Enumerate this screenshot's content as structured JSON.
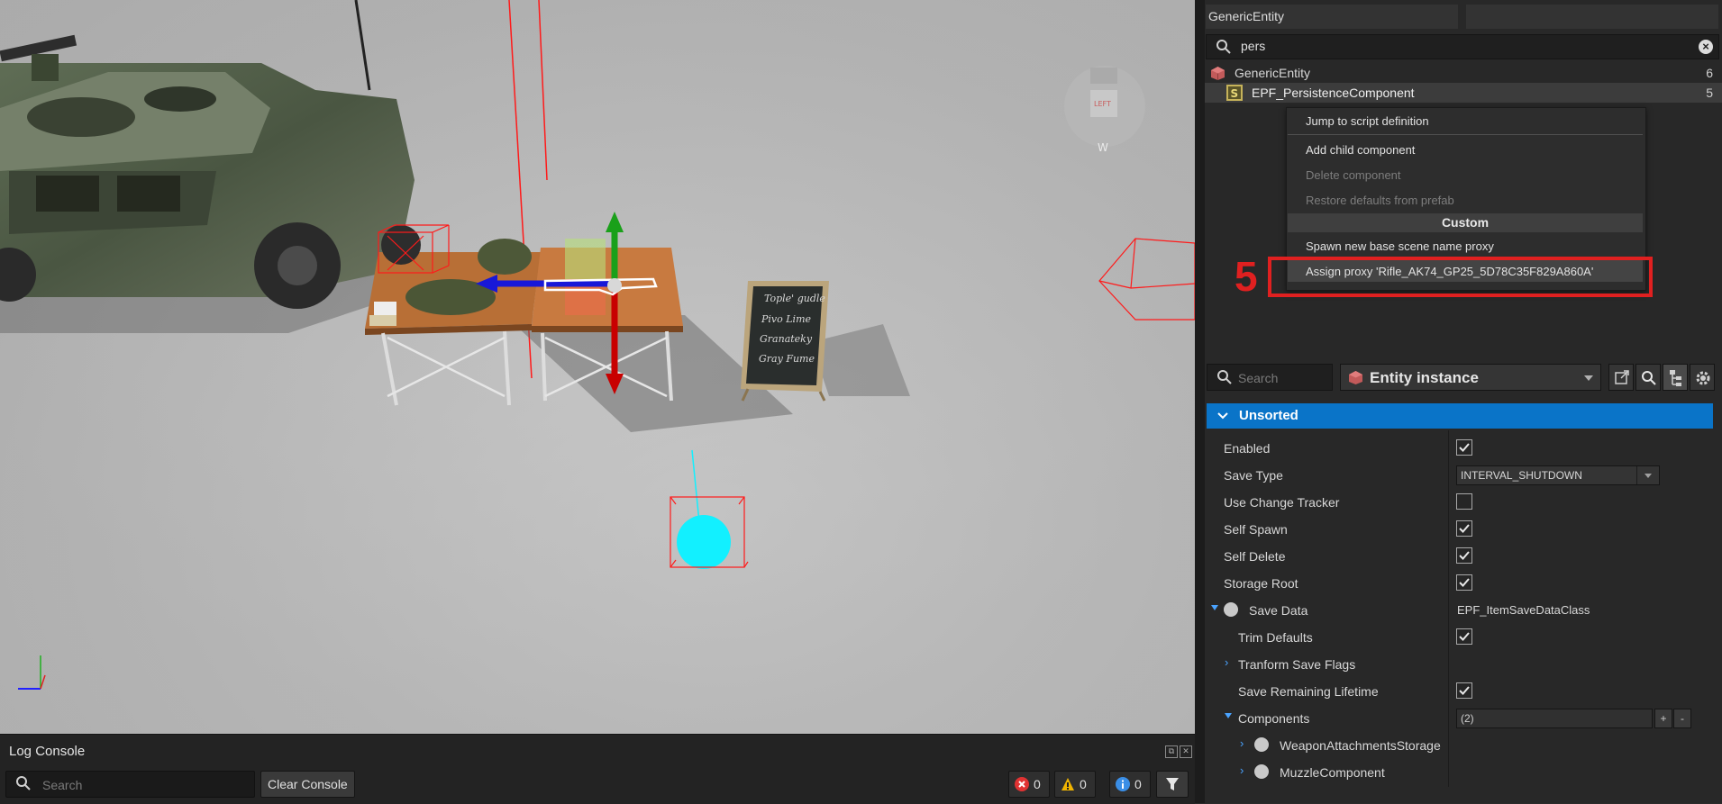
{
  "hierarchy": {
    "entity_field": "GenericEntity",
    "search_value": "pers",
    "rows": [
      {
        "label": "GenericEntity",
        "count": "6"
      },
      {
        "label": "EPF_PersistenceComponent",
        "count": "5"
      }
    ]
  },
  "context_menu": {
    "items": {
      "jump": "Jump to script definition",
      "add_child": "Add child component",
      "delete": "Delete component",
      "restore": "Restore defaults from prefab",
      "custom_header": "Custom",
      "spawn_proxy": "Spawn new base scene name proxy",
      "assign_proxy": "Assign proxy 'Rifle_AK74_GP25_5D78C35F829A860A'"
    }
  },
  "annotation": {
    "step": "5",
    "color": "#e02020"
  },
  "properties": {
    "search_placeholder": "Search",
    "type_label": "Entity instance",
    "section": "Unsorted",
    "rows": {
      "enabled": {
        "label": "Enabled",
        "checked": true
      },
      "save_type": {
        "label": "Save Type",
        "value": "INTERVAL_SHUTDOWN"
      },
      "use_change_tracker": {
        "label": "Use Change Tracker",
        "checked": false
      },
      "self_spawn": {
        "label": "Self Spawn",
        "checked": true
      },
      "self_delete": {
        "label": "Self Delete",
        "checked": true
      },
      "storage_root": {
        "label": "Storage Root",
        "checked": true
      },
      "save_data": {
        "label": "Save Data",
        "value": "EPF_ItemSaveDataClass"
      },
      "trim_defaults": {
        "label": "Trim Defaults",
        "checked": true
      },
      "transform_flags": {
        "label": "Tranform Save Flags"
      },
      "save_remaining_lifetime": {
        "label": "Save Remaining Lifetime",
        "checked": true
      },
      "components": {
        "label": "Components",
        "value": "(2)",
        "add": "+",
        "remove": "-"
      },
      "weapon_attachments": {
        "label": "WeaponAttachmentsStorage"
      },
      "muzzle": {
        "label": "MuzzleComponent"
      }
    }
  },
  "log_console": {
    "title": "Log Console",
    "search_placeholder": "Search",
    "clear_label": "Clear Console",
    "errors": "0",
    "warnings": "0",
    "infos": "0"
  },
  "viewport": {
    "chalkboard_lines": [
      "Tople' gudle",
      "Pivo Lime",
      "Granateky",
      "Gray Fume"
    ],
    "gizmo_label": "LEFT",
    "gizmo_sub": "W"
  },
  "colors": {
    "accent": "#0a74c8",
    "selection_wire": "#ff1a1a",
    "cyan_sphere": "#12f0ff",
    "error": "#e03232",
    "warning": "#f0b400",
    "info": "#3a8ee6"
  }
}
